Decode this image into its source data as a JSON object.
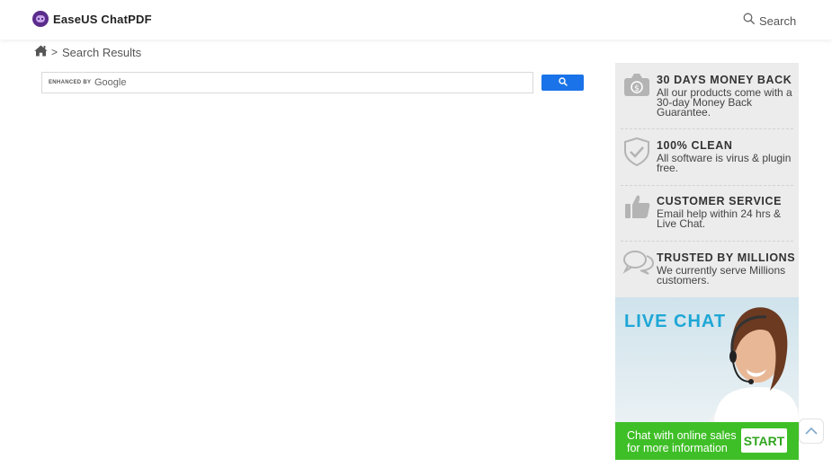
{
  "header": {
    "brand": "EaseUS ChatPDF",
    "search_label": "Search"
  },
  "breadcrumb": {
    "separator": ">",
    "current": "Search Results"
  },
  "search_box": {
    "enhanced_by": "ENHANCED BY",
    "provider": "Google"
  },
  "sidebar": {
    "features": [
      {
        "icon": "money-bag-icon",
        "title": "30 DAYS MONEY BACK",
        "text": "All our products come with a 30-day Money Back Guarantee."
      },
      {
        "icon": "shield-check-icon",
        "title": "100% CLEAN",
        "text": "All software is virus & plugin free."
      },
      {
        "icon": "thumbs-up-icon",
        "title": "CUSTOMER SERVICE",
        "text": "Email help within 24 hrs & Live Chat."
      },
      {
        "icon": "chat-bubbles-icon",
        "title": "TRUSTED BY MILLIONS",
        "text": "We currently serve Millions customers."
      }
    ]
  },
  "live_chat": {
    "title": "LIVE CHAT",
    "line1": "Chat with online sales",
    "line2": "for more information",
    "button": "START"
  },
  "colors": {
    "accent_blue": "#1a73e8",
    "sidebar_bg": "#ececec",
    "chat_green": "#3fbf27",
    "chat_title": "#1ea7d6"
  }
}
